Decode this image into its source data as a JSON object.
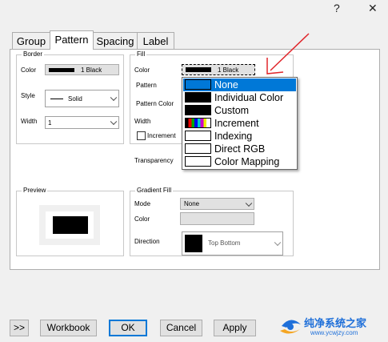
{
  "titlebar": {
    "help_label": "?",
    "close_label": "✕"
  },
  "tabs": [
    {
      "label": "Group"
    },
    {
      "label": "Pattern"
    },
    {
      "label": "Spacing"
    },
    {
      "label": "Label"
    }
  ],
  "border": {
    "legend": "Border",
    "color_label": "Color",
    "color_value": "1 Black",
    "style_label": "Style",
    "style_value": "Solid",
    "width_label": "Width",
    "width_value": "1"
  },
  "fill": {
    "legend": "Fill",
    "color_label": "Color",
    "color_value": "1 Black",
    "pattern_label": "Pattern",
    "pattern_color_label": "Pattern Color",
    "width_label": "Width",
    "increment_label": "Increment",
    "transparency_label": "Transparency"
  },
  "color_dropdown": {
    "items": [
      {
        "label": "None",
        "swatch": "#0078d7"
      },
      {
        "label": "Individual Color",
        "swatch": "#000000"
      },
      {
        "label": "Custom",
        "swatch": "#000000"
      },
      {
        "label": "Increment",
        "swatch": "multicolor"
      },
      {
        "label": "Indexing",
        "swatch": "#ffffff"
      },
      {
        "label": "Direct RGB",
        "swatch": "#ffffff"
      },
      {
        "label": "Color Mapping",
        "swatch": "#ffffff"
      }
    ],
    "selected": "None"
  },
  "preview": {
    "legend": "Preview"
  },
  "gradient": {
    "legend": "Gradient Fill",
    "mode_label": "Mode",
    "mode_value": "None",
    "color_label": "Color",
    "direction_label": "Direction",
    "direction_value": "Top Bottom"
  },
  "buttons": {
    "expand": ">>",
    "workbook": "Workbook",
    "ok": "OK",
    "cancel": "Cancel",
    "apply": "Apply"
  },
  "colors": {
    "accent": "#0078d7",
    "annotation_arrow": "#e0262b"
  },
  "watermark": {
    "brand": "纯净系统之家",
    "url": "www.ycwjzy.com"
  }
}
